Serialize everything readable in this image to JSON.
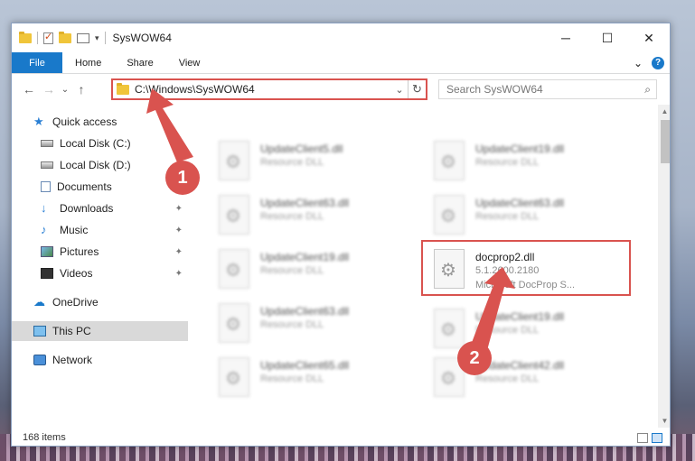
{
  "window": {
    "title": "SysWOW64",
    "controls": {
      "minimize": "─",
      "maximize": "☐",
      "close": "✕"
    }
  },
  "ribbon": {
    "tabs": [
      "File",
      "Home",
      "Share",
      "View"
    ],
    "expand": "⌄",
    "help": "?"
  },
  "nav": {
    "back": "←",
    "forward": "→",
    "recent": "⌄",
    "up": "↑",
    "address": "C:\\Windows\\SysWOW64",
    "dropdown": "⌄",
    "refresh": "↻",
    "search_placeholder": "Search SysWOW64",
    "search_icon": "⌕"
  },
  "sidebar": {
    "items": [
      {
        "label": "Quick access",
        "icon": "star-icon",
        "pinned": false
      },
      {
        "label": "Local Disk (C:)",
        "icon": "drive-icon",
        "pinned": true
      },
      {
        "label": "Local Disk (D:)",
        "icon": "drive-icon",
        "pinned": true
      },
      {
        "label": "Documents",
        "icon": "documents-icon",
        "pinned": true
      },
      {
        "label": "Downloads",
        "icon": "download-icon",
        "pinned": true
      },
      {
        "label": "Music",
        "icon": "music-icon",
        "pinned": true
      },
      {
        "label": "Pictures",
        "icon": "pictures-icon",
        "pinned": true
      },
      {
        "label": "Videos",
        "icon": "videos-icon",
        "pinned": true
      },
      {
        "label": "OneDrive",
        "icon": "onedrive-icon",
        "pinned": false
      },
      {
        "label": "This PC",
        "icon": "computer-icon",
        "pinned": false,
        "selected": true
      },
      {
        "label": "Network",
        "icon": "network-icon",
        "pinned": false
      }
    ],
    "pin_glyph": "📌"
  },
  "files": {
    "blurred": [
      {
        "name": "UpdateClient5.dll",
        "type": "Resource DLL"
      },
      {
        "name": "UpdateClient19.dll",
        "type": "Resource DLL"
      },
      {
        "name": "UpdateClient63.dll",
        "type": "Resource DLL"
      },
      {
        "name": "UpdateClient63.dll",
        "type": "Resource DLL"
      },
      {
        "name": "UpdateClient19.dll",
        "type": "Resource DLL"
      },
      {
        "name": "UpdateClient63.dll",
        "type": "Resource DLL"
      },
      {
        "name": "UpdateClient19.dll",
        "type": "Resource DLL"
      },
      {
        "name": "UpdateClient65.dll",
        "type": "Resource DLL"
      },
      {
        "name": "UpdateClient42.dll",
        "type": "Resource DLL"
      }
    ],
    "focused": {
      "name": "docprop2.dll",
      "version": "5.1.2600.2180",
      "description": "Microsoft DocProp S..."
    }
  },
  "status": {
    "item_count": "168 items"
  },
  "annotations": {
    "step1": "1",
    "step2": "2",
    "color": "#d9534f"
  }
}
